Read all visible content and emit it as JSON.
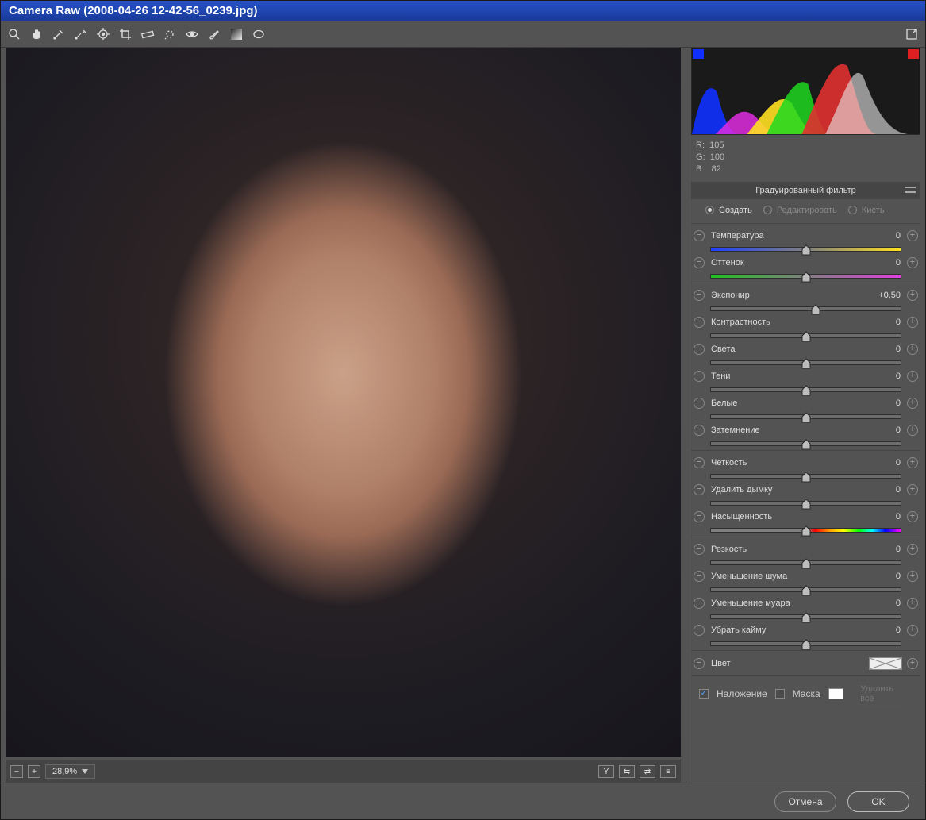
{
  "window": {
    "title": "Camera Raw (2008-04-26 12-42-56_0239.jpg)"
  },
  "readout": {
    "r_label": "R:",
    "r": "105",
    "g_label": "G:",
    "g": "100",
    "b_label": "B:",
    "b": "82"
  },
  "panel": {
    "title": "Градуированный фильтр",
    "modes": {
      "create": "Создать",
      "edit": "Редактировать",
      "brush": "Кисть"
    }
  },
  "sliders": {
    "group1": [
      {
        "id": "temperature",
        "label": "Температура",
        "value": "0",
        "track": "temp",
        "pos": 50
      },
      {
        "id": "tint",
        "label": "Оттенок",
        "value": "0",
        "track": "tint",
        "pos": 50
      }
    ],
    "group2": [
      {
        "id": "exposure",
        "label": "Экспонир",
        "value": "+0,50",
        "track": "",
        "pos": 55
      },
      {
        "id": "contrast",
        "label": "Контрастность",
        "value": "0",
        "track": "",
        "pos": 50
      },
      {
        "id": "highlights",
        "label": "Света",
        "value": "0",
        "track": "",
        "pos": 50
      },
      {
        "id": "shadows",
        "label": "Тени",
        "value": "0",
        "track": "",
        "pos": 50
      },
      {
        "id": "whites",
        "label": "Белые",
        "value": "0",
        "track": "",
        "pos": 50
      },
      {
        "id": "blacks",
        "label": "Затемнение",
        "value": "0",
        "track": "",
        "pos": 50
      }
    ],
    "group3": [
      {
        "id": "clarity",
        "label": "Четкость",
        "value": "0",
        "track": "",
        "pos": 50
      },
      {
        "id": "dehaze",
        "label": "Удалить дымку",
        "value": "0",
        "track": "",
        "pos": 50
      },
      {
        "id": "saturation",
        "label": "Насыщенность",
        "value": "0",
        "track": "sat",
        "pos": 50
      }
    ],
    "group4": [
      {
        "id": "sharpness",
        "label": "Резкость",
        "value": "0",
        "track": "",
        "pos": 50
      },
      {
        "id": "noise",
        "label": "Уменьшение шума",
        "value": "0",
        "track": "",
        "pos": 50
      },
      {
        "id": "moire",
        "label": "Уменьшение муара",
        "value": "0",
        "track": "",
        "pos": 50
      },
      {
        "id": "defringe",
        "label": "Убрать кайму",
        "value": "0",
        "track": "",
        "pos": 50
      }
    ],
    "color_label": "Цвет"
  },
  "overlay": {
    "overlay_label": "Наложение",
    "mask_label": "Маска",
    "clear_label": "Удалить все"
  },
  "status": {
    "zoom": "28,9%"
  },
  "footer": {
    "cancel": "Отмена",
    "ok": "OK"
  }
}
